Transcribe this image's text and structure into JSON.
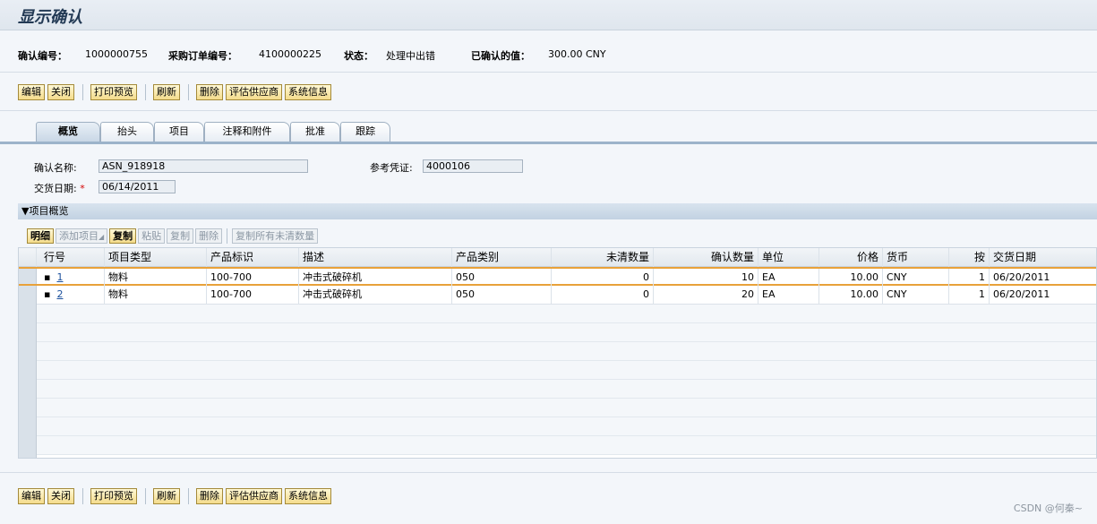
{
  "page": {
    "title": "显示确认"
  },
  "info": {
    "confirm_no_label": "确认编号：",
    "confirm_no": "1000000755",
    "po_no_label": "采购订单编号：",
    "po_no": "4100000225",
    "status_label": "状态：",
    "status": "处理中出错",
    "confirmed_value_label": "已确认的值：",
    "confirmed_value": "300.00 CNY"
  },
  "toolbar": {
    "edit": "编辑",
    "close": "关闭",
    "print_preview": "打印预览",
    "refresh": "刷新",
    "delete": "删除",
    "evaluate_supplier": "评估供应商",
    "system_info": "系统信息"
  },
  "tabs": [
    "概览",
    "抬头",
    "项目",
    "注释和附件",
    "批准",
    "跟踪"
  ],
  "form": {
    "confirm_name_label": "确认名称:",
    "confirm_name": "ASN_918918",
    "ref_doc_label": "参考凭证:",
    "ref_doc": "4000106",
    "delivery_date_label": "交货日期:",
    "required_mark": "*",
    "delivery_date": "06/14/2011"
  },
  "section": {
    "title": "▼项目概览"
  },
  "table_toolbar": {
    "detail": "明细",
    "add_item": "添加项目",
    "add_item_arrow": "◢",
    "copy": "复制",
    "paste": "粘贴",
    "copy2": "复制",
    "delete": "删除",
    "copy_all_open": "复制所有未清数量"
  },
  "table": {
    "headers": [
      "行号",
      "项目类型",
      "产品标识",
      "描述",
      "产品类别",
      "未清数量",
      "确认数量",
      "单位",
      "价格",
      "货币",
      "按",
      "交货日期"
    ],
    "rows": [
      {
        "bullet": "▪",
        "line": "1",
        "type": "物料",
        "product_id": "100-700",
        "desc": "冲击式破碎机",
        "category": "050",
        "open_qty": "0",
        "conf_qty": "10",
        "unit": "EA",
        "price": "10.00",
        "currency": "CNY",
        "per": "1",
        "date": "06/20/2011"
      },
      {
        "bullet": "▪",
        "line": "2",
        "type": "物料",
        "product_id": "100-700",
        "desc": "冲击式破碎机",
        "category": "050",
        "open_qty": "0",
        "conf_qty": "20",
        "unit": "EA",
        "price": "10.00",
        "currency": "CNY",
        "per": "1",
        "date": "06/20/2011"
      }
    ]
  },
  "watermark": "CSDN @何秦~"
}
